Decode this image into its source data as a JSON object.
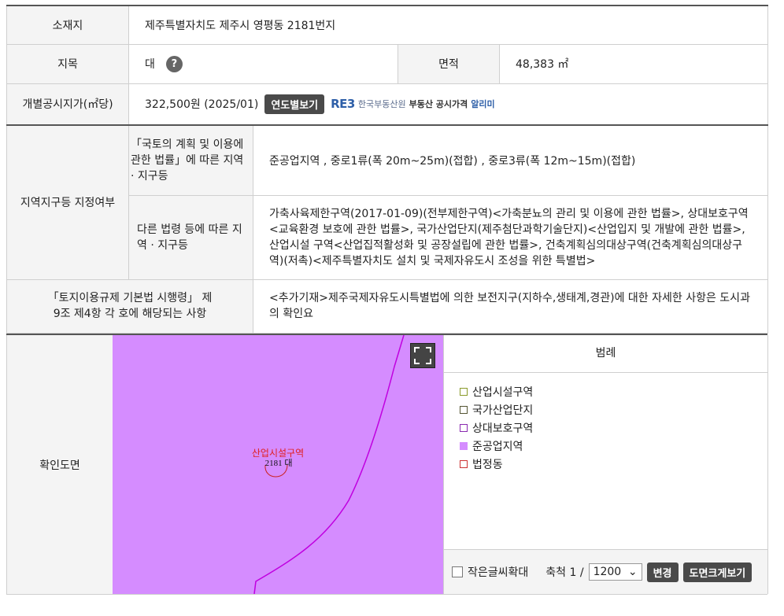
{
  "location": {
    "label": "소재지",
    "value": "제주특별자치도 제주시 영평동 2181번지"
  },
  "land_category": {
    "label": "지목",
    "value": "대",
    "help_icon": "?"
  },
  "area": {
    "label": "면적",
    "value": "48,383 ㎡"
  },
  "price": {
    "label": "개별공시지가(㎡당)",
    "value": "322,500원 (2025/01)",
    "yearly_button": "연도별보기",
    "reb_logo": "RE3",
    "reb_org": "한국부동산원",
    "reb_service": "부동산 공시가격",
    "reb_alimi": "알리미"
  },
  "zoning": {
    "label": "지역지구등 지정여부",
    "national_label": "「국토의 계획 및 이용에 관한 법률」에 따른 지역 · 지구등",
    "national_value": "준공업지역 , 중로1류(폭 20m~25m)(접합) , 중로3류(폭 12m~15m)(접합)",
    "other_label": "다른 법령 등에 따른 지역 · 지구등",
    "other_value": "가축사육제한구역(2017-01-09)(전부제한구역)<가축분뇨의 관리 및 이용에 관한 법률>, 상대보호구역<교육환경 보호에 관한 법률>, 국가산업단지(제주첨단과학기술단지)<산업입지 및 개발에 관한 법률>, 산업시설 구역<산업집적활성화 및 공장설립에 관한 법률>, 건축계획심의대상구역(건축계획심의대상구역)(저촉)<제주특별자치도 설치 및 국제자유도시 조성을 위한 특별법>"
  },
  "regulation": {
    "label": "「토지이용규제 기본법 시행령」 제9조 제4항 각 호에 해당되는 사항",
    "value": "<추가기재>제주국제자유도시특별법에 의한 보전지구(지하수,생태계,경관)에 대한 자세한 사항은 도시과의 확인요"
  },
  "map": {
    "label": "확인도면",
    "fill_color": "#d58cff",
    "zone_label": "산업시설구역",
    "parcel_label": "2181 대"
  },
  "legend": {
    "title": "범례",
    "items": [
      {
        "label": "산업시설구역",
        "color": "#8a9a2a",
        "filled": false
      },
      {
        "label": "국가산업단지",
        "color": "#555533",
        "filled": false
      },
      {
        "label": "상대보호구역",
        "color": "#8a2ab0",
        "filled": false
      },
      {
        "label": "준공업지역",
        "color": "#d58cff",
        "filled": true
      },
      {
        "label": "법정동",
        "color": "#cc3333",
        "filled": false
      }
    ]
  },
  "controls": {
    "small_font_label": "작은글씨확대",
    "scale_label": "축척 1 /",
    "scale_value": "1200",
    "change_button": "변경",
    "enlarge_button": "도면크게보기"
  }
}
